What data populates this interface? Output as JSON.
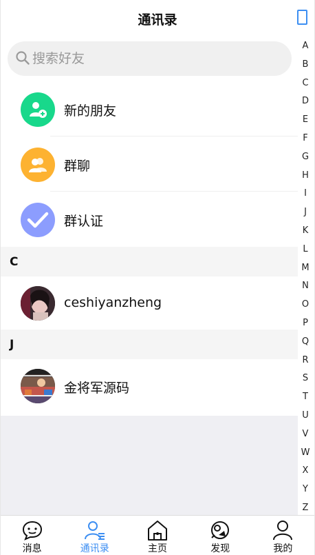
{
  "header": {
    "title": "通讯录"
  },
  "search": {
    "placeholder": "搜索好友"
  },
  "features": [
    {
      "label": "新的朋友",
      "color": "#18d88b",
      "icon": "add-user-icon"
    },
    {
      "label": "群聊",
      "color": "#fdb231",
      "icon": "group-icon"
    },
    {
      "label": "群认证",
      "color": "#8c9dfe",
      "icon": "check-icon"
    }
  ],
  "sections": [
    {
      "letter": "C",
      "contacts": [
        {
          "name": "ceshiyanzheng"
        }
      ]
    },
    {
      "letter": "J",
      "contacts": [
        {
          "name": "金将军源码"
        }
      ]
    }
  ],
  "index_letters": [
    "A",
    "B",
    "C",
    "D",
    "E",
    "F",
    "G",
    "H",
    "I",
    "J",
    "K",
    "L",
    "M",
    "N",
    "O",
    "P",
    "Q",
    "R",
    "S",
    "T",
    "U",
    "V",
    "W",
    "X",
    "Y",
    "Z"
  ],
  "tabbar": [
    {
      "label": "消息",
      "icon": "chat-bubble-icon",
      "active": false
    },
    {
      "label": "通讯录",
      "icon": "contacts-icon",
      "active": true
    },
    {
      "label": "主页",
      "icon": "home-icon",
      "active": false
    },
    {
      "label": "发现",
      "icon": "discover-icon",
      "active": false
    },
    {
      "label": "我的",
      "icon": "profile-icon",
      "active": false
    }
  ],
  "colors": {
    "accent": "#3c8ef2"
  }
}
